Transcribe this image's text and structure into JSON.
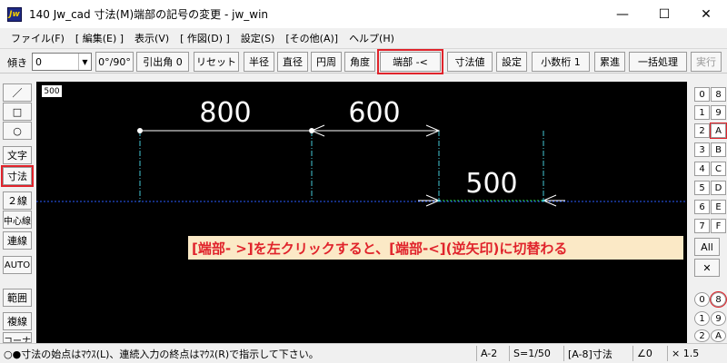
{
  "window": {
    "title": "140 Jw_cad 寸法(M)端部の記号の変更 - jw_win",
    "icon_label": "Jw",
    "minimize": "—",
    "maximize": "☐",
    "close": "✕"
  },
  "menu": [
    "ファイル(F)",
    "[ 編集(E) ]",
    "表示(V)",
    "[ 作図(D) ]",
    "設定(S)",
    "[その他(A)]",
    "ヘルプ(H)"
  ],
  "toolbar": {
    "tilt_label": "傾き",
    "tilt_value": "0",
    "buttons": [
      "0°/90°",
      "引出角 0",
      "リセット",
      "半径",
      "直径",
      "円周",
      "角度",
      "端部 -<",
      "寸法値",
      "設定",
      "小数桁 1",
      "累進",
      "一括処理",
      "実行"
    ]
  },
  "left_palette": [
    "／",
    "□",
    "○",
    "文字",
    "寸法",
    "２線",
    "中心線",
    "連線",
    "AUTO",
    "範囲",
    "複線",
    "コーナー"
  ],
  "canvas": {
    "scale_badge": "500",
    "dimensions": [
      "800",
      "600",
      "500"
    ],
    "annotation": "[端部- >]を左クリックすると、[端部-<](逆矢印)に切替わる"
  },
  "right_palette": {
    "layer_rows": [
      [
        "0",
        "8"
      ],
      [
        "1",
        "9"
      ],
      [
        "2",
        "A"
      ],
      [
        "3",
        "B"
      ],
      [
        "4",
        "C"
      ],
      [
        "5",
        "D"
      ],
      [
        "6",
        "E"
      ],
      [
        "7",
        "F"
      ]
    ],
    "all_label": "All",
    "x_label": "✕",
    "group_rows": [
      [
        "0",
        "8"
      ],
      [
        "1",
        "9"
      ],
      [
        "2",
        "A"
      ]
    ]
  },
  "status": {
    "message": "○●寸法の始点はﾏｳｽ(L)、連続入力の終点はﾏｳｽ(R)で指示して下さい。",
    "cells": [
      "A-2",
      "S=1/50",
      "[A-8]寸法",
      "∠0",
      "× 1.5"
    ]
  },
  "colors": {
    "highlight": "#e0232b",
    "dimension_line": "#44c9d6",
    "dashed_line": "#2a5cff",
    "annotation_bg": "#fbe9c6"
  }
}
